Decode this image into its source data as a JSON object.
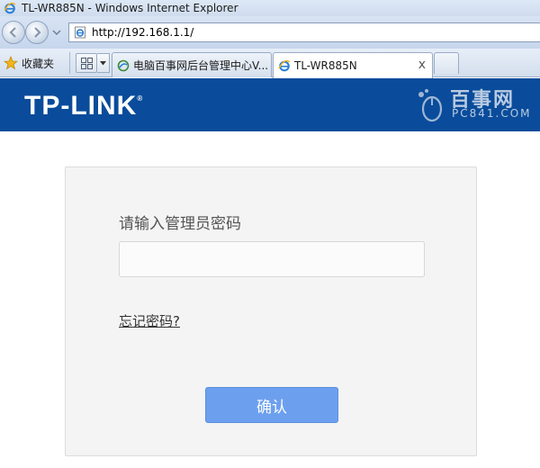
{
  "window": {
    "title": "TL-WR885N - Windows Internet Explorer"
  },
  "navigation": {
    "url": "http://192.168.1.1/",
    "back_icon": "back-arrow-icon",
    "forward_icon": "forward-arrow-icon"
  },
  "favorites": {
    "label": "收藏夹",
    "icon": "star-icon"
  },
  "tabs": [
    {
      "label": "电脑百事网后台管理中心V...",
      "active": false
    },
    {
      "label": "TL-WR885N",
      "active": true,
      "close": "x"
    }
  ],
  "brand": {
    "logo": "TP-LINK",
    "watermark_text": "百事网",
    "watermark_url": "PC841.COM"
  },
  "login": {
    "password_label": "请输入管理员密码",
    "password_value": "",
    "forgot_link": "忘记密码?",
    "confirm_button": "确认"
  },
  "colors": {
    "brand_blue": "#0a4c9b",
    "button_blue": "#6ca0ef",
    "card_bg": "#f4f4f4"
  }
}
